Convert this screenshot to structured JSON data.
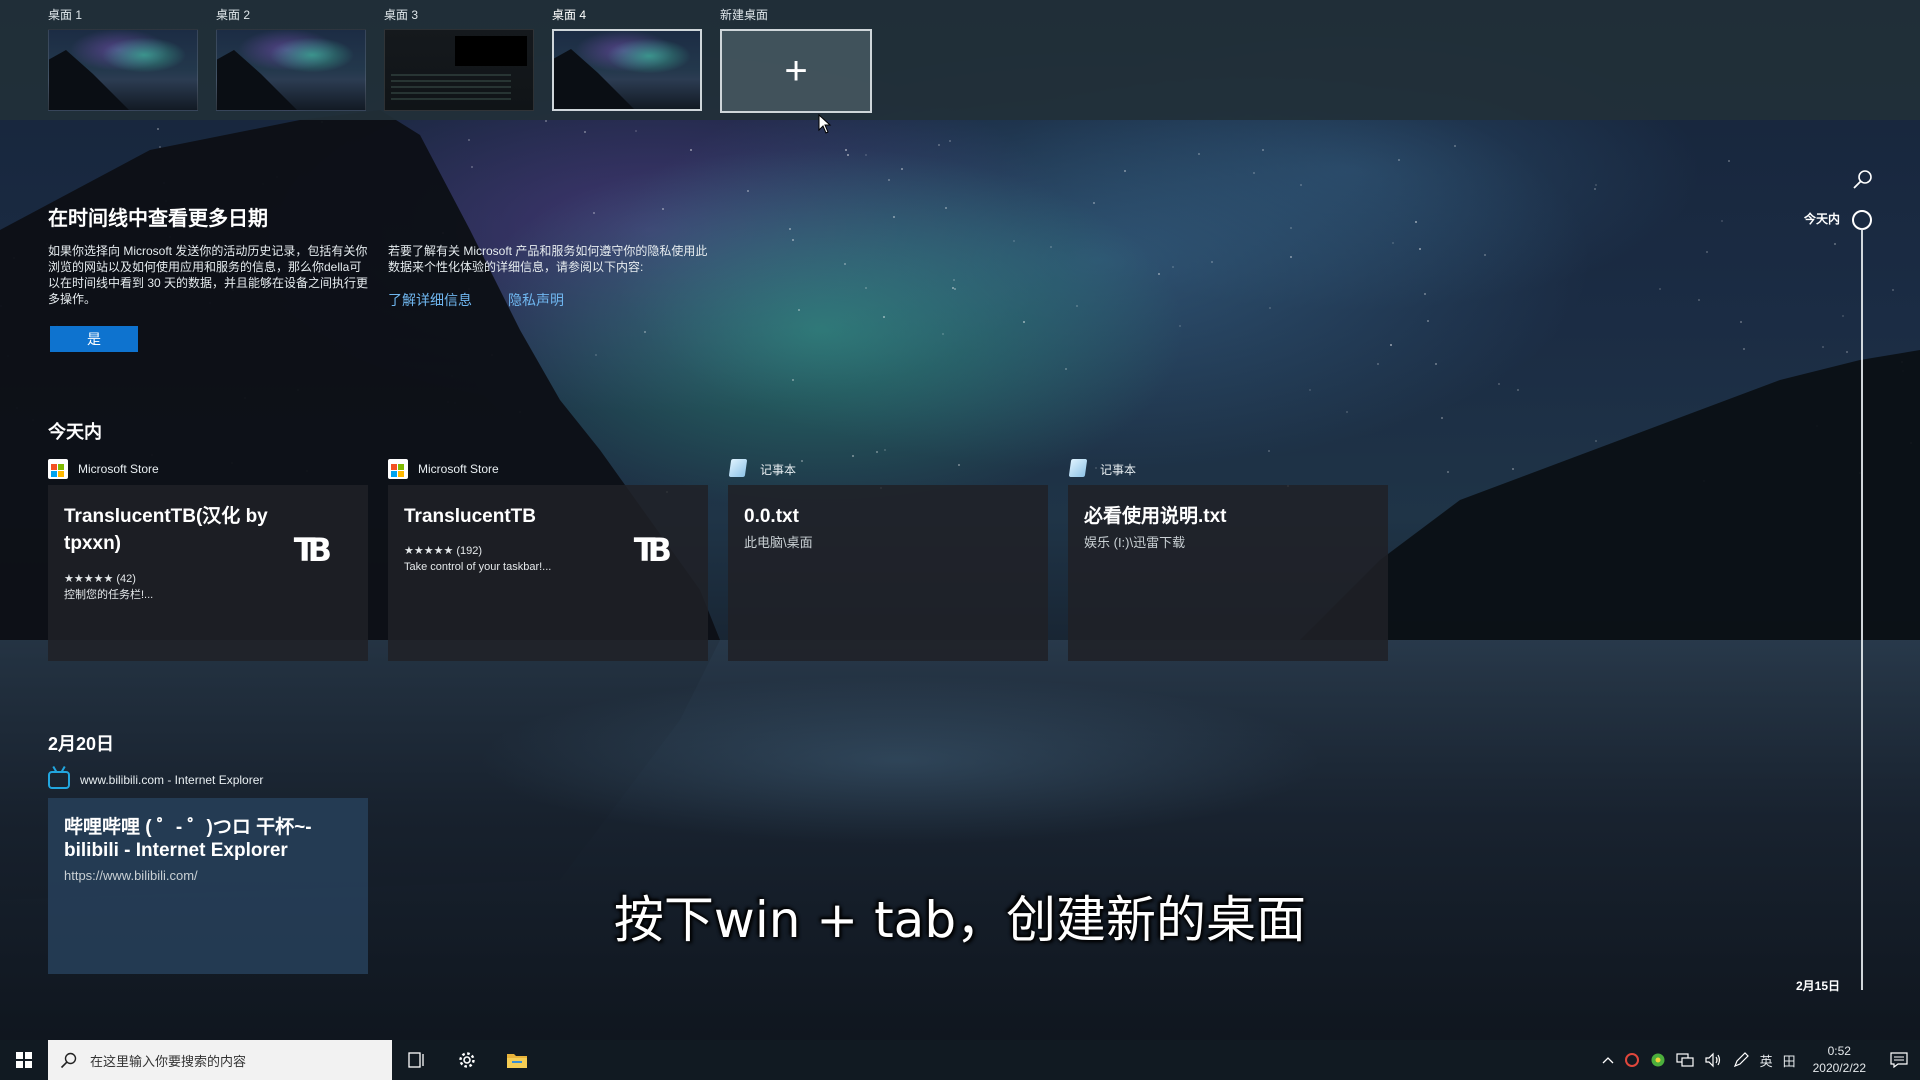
{
  "desktops": [
    {
      "label": "桌面 1",
      "active": false
    },
    {
      "label": "桌面 2",
      "active": false
    },
    {
      "label": "桌面 3",
      "active": false
    },
    {
      "label": "桌面 4",
      "active": true
    }
  ],
  "new_desktop": {
    "label": "新建桌面",
    "icon": "plus-icon",
    "glyph": "+"
  },
  "promo": {
    "title": "在时间线中查看更多日期",
    "text_left": "如果你选择向 Microsoft 发送你的活动历史记录，包括有关你浏览的网站以及如何使用应用和服务的信息，那么你della可以在时间线中看到 30 天的数据，并且能够在设备之间执行更多操作。",
    "text_right": "若要了解有关 Microsoft 产品和服务如何遵守你的隐私使用此数据来个性化体验的详细信息，请参阅以下内容:",
    "link_details": "了解详细信息",
    "link_privacy": "隐私声明",
    "yes_button": "是"
  },
  "sections": {
    "today": {
      "heading": "今天内",
      "cards": [
        {
          "app": "Microsoft Store",
          "app_icon": "microsoft-store-icon",
          "title": "TranslucentTB(汉化 by tpxxn)",
          "rating": "★★★★★ (42)",
          "desc": "控制您的任务栏!...",
          "logo": "TB"
        },
        {
          "app": "Microsoft Store",
          "app_icon": "microsoft-store-icon",
          "title": "TranslucentTB",
          "rating": "★★★★★ (192)",
          "desc": "Take control of your taskbar!...",
          "logo": "TB"
        },
        {
          "app": "记事本",
          "app_icon": "notepad-icon",
          "title": "0.0.txt",
          "path": "此电脑\\桌面"
        },
        {
          "app": "记事本",
          "app_icon": "notepad-icon",
          "title": "必看使用说明.txt",
          "path": "娱乐 (I:)\\迅雷下载"
        }
      ]
    },
    "feb20": {
      "heading": "2月20日",
      "cards": [
        {
          "app": "www.bilibili.com - Internet Explorer",
          "app_icon": "bilibili-icon",
          "title": "哔哩哔哩 ( ゜- ゜)つロ 干杯~-bilibili - Internet Explorer",
          "url": "https://www.bilibili.com/"
        }
      ]
    }
  },
  "timeline": {
    "top_label": "今天内",
    "bottom_label": "2月15日",
    "search_icon": "search-icon"
  },
  "subtitle": "按下win + tab，创建新的桌面",
  "taskbar": {
    "search_placeholder": "在这里输入你要搜索的内容",
    "tray_lang": "英",
    "tray_ime": "田",
    "clock_time": "0:52",
    "clock_date": "2020/2/22"
  },
  "colors": {
    "accent": "#0e73cf",
    "link": "#6fb6ef",
    "card_bg": "#202126",
    "web_card_bg": "#263e58"
  }
}
